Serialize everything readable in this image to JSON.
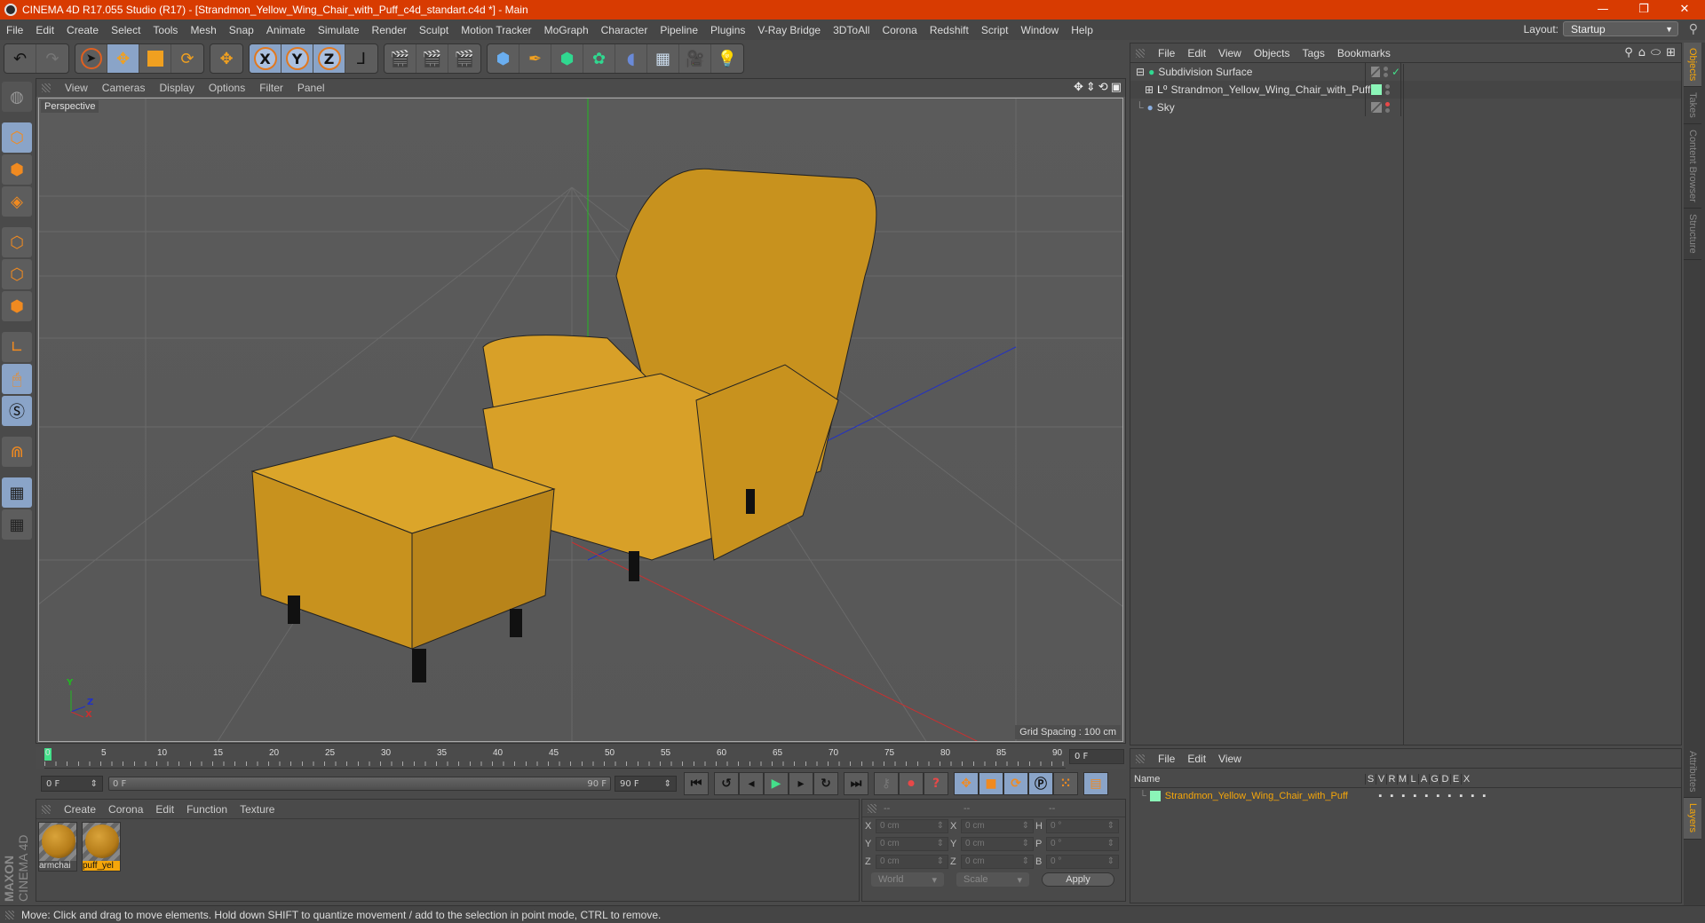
{
  "window": {
    "title": "CINEMA 4D R17.055 Studio (R17) - [Strandmon_Yellow_Wing_Chair_with_Puff_c4d_standart.c4d *] - Main",
    "controls": {
      "minimize": "—",
      "restore": "❐",
      "close": "✕"
    }
  },
  "menubar": [
    "File",
    "Edit",
    "Create",
    "Select",
    "Tools",
    "Mesh",
    "Snap",
    "Animate",
    "Simulate",
    "Render",
    "Sculpt",
    "Motion Tracker",
    "MoGraph",
    "Character",
    "Pipeline",
    "Plugins",
    "V-Ray Bridge",
    "3DToAll",
    "Corona",
    "Redshift",
    "Script",
    "Window",
    "Help"
  ],
  "layout": {
    "label": "Layout:",
    "value": "Startup"
  },
  "toolbar": {
    "undo": "↶",
    "redo": "↷",
    "axis_x": "X",
    "axis_y": "Y",
    "axis_z": "Z"
  },
  "viewport": {
    "menu": [
      "View",
      "Cameras",
      "Display",
      "Options",
      "Filter",
      "Panel"
    ],
    "camera_label": "Perspective",
    "grid_spacing": "Grid Spacing : 100 cm",
    "axis_labels": {
      "x": "X",
      "y": "Y",
      "z": "Z"
    },
    "colors": {
      "x_axis": "#c83030",
      "y_axis": "#22b822",
      "z_axis": "#2030c8",
      "object": "#d8a028"
    }
  },
  "timeline": {
    "ticks": [
      "0",
      "5",
      "10",
      "15",
      "20",
      "25",
      "30",
      "35",
      "40",
      "45",
      "50",
      "55",
      "60",
      "65",
      "70",
      "75",
      "80",
      "85",
      "90"
    ],
    "current_frame": "0 F",
    "start_field": "0 F",
    "range_start": "0 F",
    "range_end": "90 F",
    "end_field": "90 F"
  },
  "material_manager": {
    "menu": [
      "Create",
      "Corona",
      "Edit",
      "Function",
      "Texture"
    ],
    "materials": [
      {
        "name": "armchai",
        "selected": false
      },
      {
        "name": "puff_yel",
        "selected": true
      }
    ],
    "branding": {
      "maxon": "MAXON",
      "product": "CINEMA 4D"
    }
  },
  "coordinates": {
    "headers": [
      "--",
      "--",
      "--"
    ],
    "rows": [
      {
        "a1": "X",
        "v1": "0 cm",
        "a2": "X",
        "v2": "0 cm",
        "a3": "H",
        "v3": "0 °"
      },
      {
        "a1": "Y",
        "v1": "0 cm",
        "a2": "Y",
        "v2": "0 cm",
        "a3": "P",
        "v3": "0 °"
      },
      {
        "a1": "Z",
        "v1": "0 cm",
        "a2": "Z",
        "v2": "0 cm",
        "a3": "B",
        "v3": "0 °"
      }
    ],
    "mode": "World",
    "transform": "Scale",
    "apply_label": "Apply"
  },
  "object_manager": {
    "menu": [
      "File",
      "Edit",
      "View",
      "Objects",
      "Tags",
      "Bookmarks"
    ],
    "objects": [
      {
        "name": "Subdivision Surface",
        "expander": "⊟",
        "tag": "check"
      },
      {
        "name": "Strandmon_Yellow_Wing_Chair_with_Puff",
        "expander": "⊞",
        "tag": "swatch"
      },
      {
        "name": "Sky",
        "expander": "",
        "tag": "red-dot"
      }
    ]
  },
  "layer_manager": {
    "menu": [
      "File",
      "Edit",
      "View"
    ],
    "columns": [
      "Name",
      "S",
      "V",
      "R",
      "M",
      "L",
      "A",
      "G",
      "D",
      "E",
      "X"
    ],
    "layers": [
      {
        "name": "Strandmon_Yellow_Wing_Chair_with_Puff",
        "color": "#8bf5b8"
      }
    ]
  },
  "side_tabs": {
    "top": [
      "Objects",
      "Takes",
      "Content Browser",
      "Structure"
    ],
    "bottom": [
      "Attributes",
      "Layers"
    ]
  },
  "status": "Move: Click and drag to move elements. Hold down SHIFT to quantize movement / add to the selection in point mode, CTRL to remove."
}
